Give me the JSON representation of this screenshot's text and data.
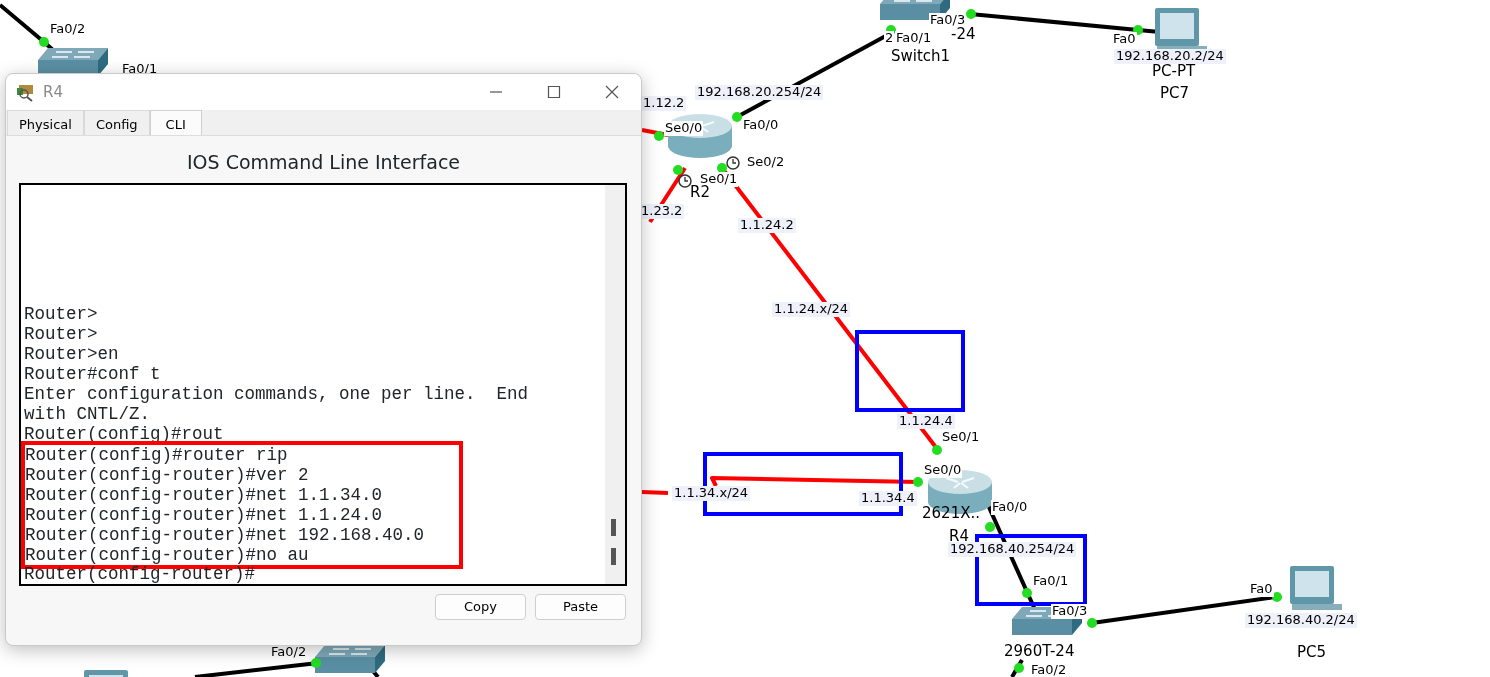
{
  "topology": {
    "devices": [
      {
        "kind": "switch"
      },
      {
        "kind": "switch"
      },
      {
        "kind": "pc"
      },
      {
        "kind": "router"
      },
      {
        "kind": "router"
      },
      {
        "kind": "switch"
      },
      {
        "kind": "pc"
      },
      {
        "kind": "switch"
      },
      {
        "kind": "pc"
      }
    ],
    "links": [
      {
        "kind": "ethernet"
      },
      {
        "kind": "ethernet"
      },
      {
        "kind": "ethernet"
      },
      {
        "kind": "serial"
      },
      {
        "kind": "serial"
      },
      {
        "kind": "serial"
      },
      {
        "kind": "serial"
      },
      {
        "kind": "serial"
      },
      {
        "kind": "ethernet"
      },
      {
        "kind": "ethernet"
      },
      {
        "kind": "ethernet"
      },
      {
        "kind": "ethernet"
      },
      {
        "kind": "ethernet"
      }
    ],
    "labels": [
      {
        "text": "Fa0/2",
        "kind": "port"
      },
      {
        "text": "Fa0/1",
        "kind": "port"
      },
      {
        "text": "Fa0/3",
        "kind": "port"
      },
      {
        "text": "2",
        "kind": "port"
      },
      {
        "text": "Fa0/1",
        "kind": "port"
      },
      {
        "text": "-24",
        "kind": "device"
      },
      {
        "text": "Switch1",
        "kind": "device"
      },
      {
        "text": "Fa0",
        "kind": "port"
      },
      {
        "text": "192.168.20.2/24",
        "kind": "ip"
      },
      {
        "text": "PC-PT",
        "kind": "device"
      },
      {
        "text": "PC7",
        "kind": "device"
      },
      {
        "text": "192.168.20.254/24",
        "kind": "ip"
      },
      {
        "text": "1.12.2",
        "kind": "ip"
      },
      {
        "text": "Se0/0",
        "kind": "port"
      },
      {
        "text": "Fa0/0",
        "kind": "port"
      },
      {
        "text": "Se0/2",
        "kind": "port"
      },
      {
        "text": "Se0/1",
        "kind": "port"
      },
      {
        "text": "R2",
        "kind": "device"
      },
      {
        "text": "1.23.2",
        "kind": "ip"
      },
      {
        "text": "1.1.24.2",
        "kind": "ip"
      },
      {
        "text": "1.1.24.x/24",
        "kind": "ip"
      },
      {
        "text": "1.1.24.4",
        "kind": "ip"
      },
      {
        "text": "Se0/1",
        "kind": "port"
      },
      {
        "text": "Se0/0",
        "kind": "port"
      },
      {
        "text": "1.1.34.x/24",
        "kind": "ip"
      },
      {
        "text": "1.1.34.4",
        "kind": "ip"
      },
      {
        "text": "2621X..",
        "kind": "device"
      },
      {
        "text": "Fa0/0",
        "kind": "port"
      },
      {
        "text": "R4",
        "kind": "device"
      },
      {
        "text": "192.168.40.254/24",
        "kind": "ip"
      },
      {
        "text": "Fa0/1",
        "kind": "port"
      },
      {
        "text": "Fa0",
        "kind": "port"
      },
      {
        "text": "Fa0/3",
        "kind": "port"
      },
      {
        "text": "192.168.40.2/24",
        "kind": "ip"
      },
      {
        "text": "Fa0/2",
        "kind": "port"
      },
      {
        "text": "2960T-24",
        "kind": "device"
      },
      {
        "text": "PC5",
        "kind": "device"
      },
      {
        "text": "Fa0/2",
        "kind": "port"
      }
    ]
  },
  "window": {
    "title": "R4",
    "tabs": [
      {
        "label": "Physical",
        "selected": false
      },
      {
        "label": "Config",
        "selected": false
      },
      {
        "label": "CLI",
        "selected": true
      }
    ],
    "heading": "IOS Command Line Interface",
    "terminal": {
      "lines": [
        {
          "text": "Router>",
          "highlighted": false
        },
        {
          "text": "Router>",
          "highlighted": false
        },
        {
          "text": "Router>en",
          "highlighted": false
        },
        {
          "text": "Router#conf t",
          "highlighted": false
        },
        {
          "text": "Enter configuration commands, one per line.  End",
          "highlighted": false
        },
        {
          "text": "with CNTL/Z.",
          "highlighted": false
        },
        {
          "text": "Router(config)#rout",
          "highlighted": false
        },
        {
          "text": "Router(config)#router rip",
          "highlighted": true
        },
        {
          "text": "Router(config-router)#ver 2",
          "highlighted": true
        },
        {
          "text": "Router(config-router)#net 1.1.34.0",
          "highlighted": true
        },
        {
          "text": "Router(config-router)#net 1.1.24.0",
          "highlighted": true
        },
        {
          "text": "Router(config-router)#net 192.168.40.0",
          "highlighted": true
        },
        {
          "text": "Router(config-router)#no au",
          "highlighted": true
        },
        {
          "text": "Router(config-router)#",
          "highlighted": false
        }
      ]
    },
    "buttons": [
      "Copy",
      "Paste"
    ]
  }
}
